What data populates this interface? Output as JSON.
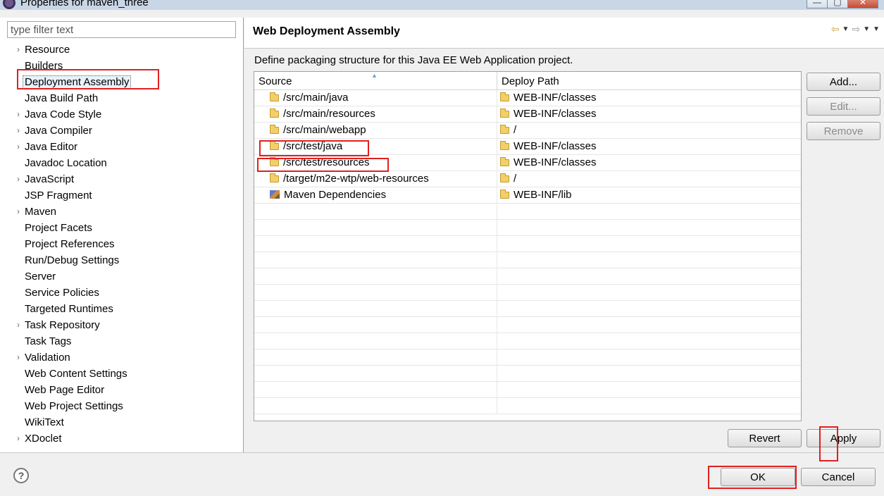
{
  "window": {
    "title": "Properties for maven_three",
    "min_label": "—",
    "max_label": "▢",
    "close_label": "✕"
  },
  "filter": {
    "placeholder": "type filter text"
  },
  "tree": {
    "items": [
      {
        "label": "Resource",
        "expandable": true
      },
      {
        "label": "Builders",
        "expandable": false
      },
      {
        "label": "Deployment Assembly",
        "expandable": false,
        "selected": true
      },
      {
        "label": "Java Build Path",
        "expandable": false
      },
      {
        "label": "Java Code Style",
        "expandable": true
      },
      {
        "label": "Java Compiler",
        "expandable": true
      },
      {
        "label": "Java Editor",
        "expandable": true
      },
      {
        "label": "Javadoc Location",
        "expandable": false
      },
      {
        "label": "JavaScript",
        "expandable": true
      },
      {
        "label": "JSP Fragment",
        "expandable": false
      },
      {
        "label": "Maven",
        "expandable": true
      },
      {
        "label": "Project Facets",
        "expandable": false
      },
      {
        "label": "Project References",
        "expandable": false
      },
      {
        "label": "Run/Debug Settings",
        "expandable": false
      },
      {
        "label": "Server",
        "expandable": false
      },
      {
        "label": "Service Policies",
        "expandable": false
      },
      {
        "label": "Targeted Runtimes",
        "expandable": false
      },
      {
        "label": "Task Repository",
        "expandable": true
      },
      {
        "label": "Task Tags",
        "expandable": false
      },
      {
        "label": "Validation",
        "expandable": true
      },
      {
        "label": "Web Content Settings",
        "expandable": false
      },
      {
        "label": "Web Page Editor",
        "expandable": false
      },
      {
        "label": "Web Project Settings",
        "expandable": false
      },
      {
        "label": "WikiText",
        "expandable": false
      },
      {
        "label": "XDoclet",
        "expandable": true
      }
    ]
  },
  "page": {
    "title": "Web Deployment Assembly",
    "description": "Define packaging structure for this Java EE Web Application project."
  },
  "table": {
    "columns": [
      "Source",
      "Deploy Path"
    ],
    "rows": [
      {
        "source": "/src/main/java",
        "source_icon": "folder-icon",
        "deploy": "WEB-INF/classes"
      },
      {
        "source": "/src/main/resources",
        "source_icon": "folder-icon",
        "deploy": "WEB-INF/classes"
      },
      {
        "source": "/src/main/webapp",
        "source_icon": "folder-icon",
        "deploy": "/"
      },
      {
        "source": "/src/test/java",
        "source_icon": "folder-icon",
        "deploy": "WEB-INF/classes"
      },
      {
        "source": "/src/test/resources",
        "source_icon": "folder-icon",
        "deploy": "WEB-INF/classes"
      },
      {
        "source": "/target/m2e-wtp/web-resources",
        "source_icon": "folder-icon",
        "deploy": "/"
      },
      {
        "source": "Maven Dependencies",
        "source_icon": "maven-library-icon",
        "deploy": "WEB-INF/lib"
      }
    ],
    "empty_rows": 13
  },
  "buttons": {
    "add": "Add...",
    "edit": "Edit...",
    "remove": "Remove",
    "revert": "Revert",
    "apply": "Apply",
    "ok": "OK",
    "cancel": "Cancel"
  },
  "icons": {
    "back": "⇦",
    "forward": "⇨",
    "dropdown": "▼",
    "help": "?",
    "chevron": "›"
  },
  "colors": {
    "annotation": "#e02020",
    "folder": "#f2cf6b"
  }
}
